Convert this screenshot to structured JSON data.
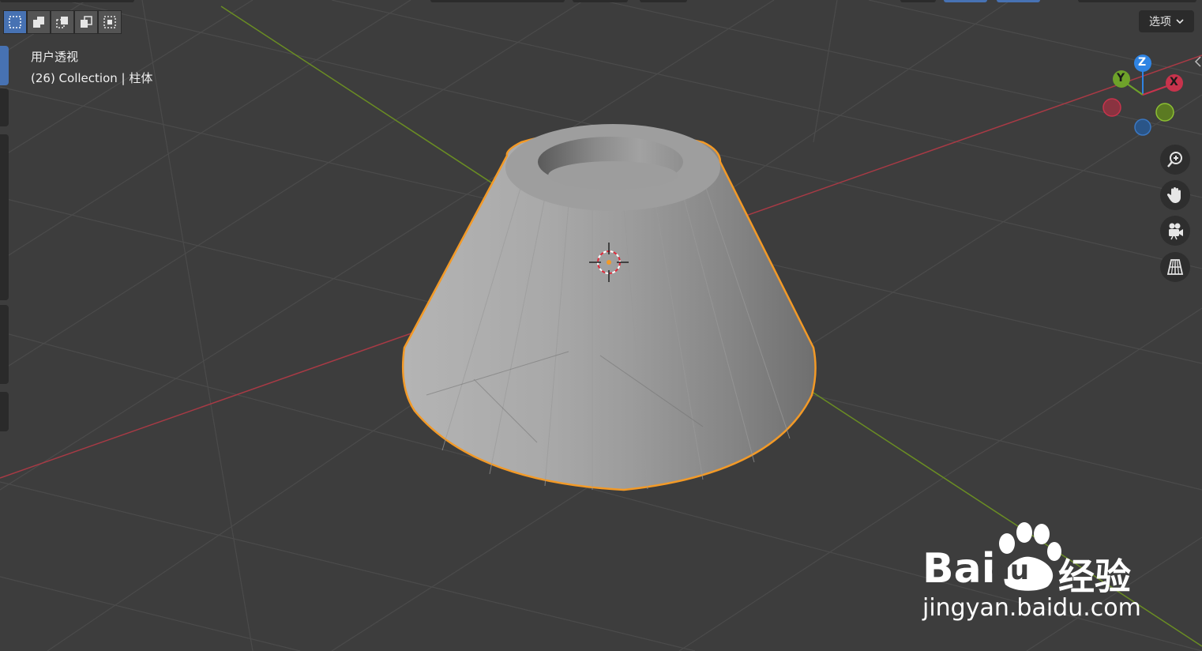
{
  "viewport": {
    "view_name": "用户透视",
    "collection_info": "(26) Collection | 柱体"
  },
  "header": {
    "options_label": "选项",
    "select_modes": [
      {
        "name": "select-new-mode",
        "active": true
      },
      {
        "name": "select-extend-mode",
        "active": false
      },
      {
        "name": "select-subtract-mode",
        "active": false
      },
      {
        "name": "select-invert-mode",
        "active": false
      },
      {
        "name": "select-intersect-mode",
        "active": false
      }
    ]
  },
  "gizmo": {
    "x_label": "X",
    "y_label": "Y",
    "z_label": "Z",
    "x_color": "#c8334c",
    "y_color": "#6ea22a",
    "z_color": "#2f84e3"
  },
  "nav_buttons": [
    "zoom-icon",
    "pan-hand-icon",
    "camera-icon",
    "perspective-grid-icon"
  ],
  "watermark": {
    "brand": "Bai",
    "brand_du": "du",
    "brand_cn": "经验",
    "url": "jingyan.baidu.com"
  },
  "colors": {
    "background": "#3d3d3d",
    "grid": "#4f4f4f",
    "x_axis": "#a83a45",
    "y_axis": "#6a8d23",
    "selection_outline": "#f39a27",
    "mesh": "#a8a8a8"
  }
}
